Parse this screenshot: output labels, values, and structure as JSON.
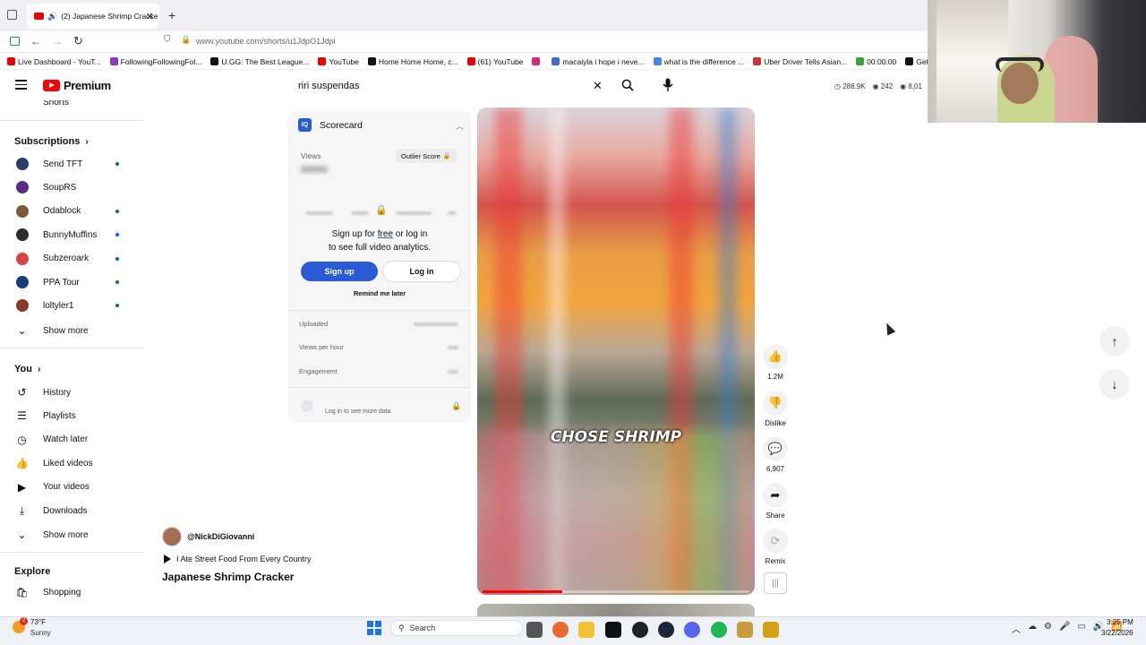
{
  "browser": {
    "tab_title": "(2) Japanese Shrimp Cracke",
    "new_tab": "+",
    "url": "www.youtube.com/shorts/u1JdpO1Jdpl"
  },
  "bookmarks": [
    {
      "label": "Live Dashboard - YouT...",
      "color": "#e00"
    },
    {
      "label": "FollowingFollowingFol...",
      "color": "#8a3ac9"
    },
    {
      "label": "U.GG: The Best League...",
      "color": "#111"
    },
    {
      "label": "YouTube",
      "color": "#e00"
    },
    {
      "label": "Home Home Home, c...",
      "color": "#111"
    },
    {
      "label": "(61) YouTube",
      "color": "#e00"
    },
    {
      "label": "",
      "color": "#d62976"
    },
    {
      "label": "macaiyla i hope i neve...",
      "color": "#3b6fd6"
    },
    {
      "label": "what is the difference ...",
      "color": "#4285f4"
    },
    {
      "label": "Uber Driver Tells Asian...",
      "color": "#c33"
    },
    {
      "label": "00:00:00",
      "color": "#3a3"
    },
    {
      "label": "Get The F--- Out Of M...",
      "color": "#111"
    }
  ],
  "header": {
    "logo_text": "Premium",
    "search_value": "riri suspendas",
    "stats": [
      "288.9K",
      "242",
      "8,01"
    ]
  },
  "sidebar": {
    "top_partial": "Shorts",
    "subscriptions_heading": "Subscriptions",
    "subscriptions": [
      {
        "label": "Send TFT",
        "color": "#2b3a6b",
        "dot": true
      },
      {
        "label": "SoupRS",
        "color": "#5d2a8a",
        "dot": false
      },
      {
        "label": "Odablock",
        "color": "#7a5a3a",
        "dot": true
      },
      {
        "label": "BunnyMuffins",
        "color": "#2c2c2c",
        "dot": true
      },
      {
        "label": "Subzeroark",
        "color": "#d94444",
        "dot": true
      },
      {
        "label": "PPA Tour",
        "color": "#1c3d7a",
        "dot": true
      },
      {
        "label": "loltyler1",
        "color": "#8a3a2a",
        "dot": true
      }
    ],
    "show_more_1": "Show more",
    "you_heading": "You",
    "you_items": [
      {
        "label": "History",
        "icon": "history-icon",
        "glyph": "↺"
      },
      {
        "label": "Playlists",
        "icon": "playlists-icon",
        "glyph": "☰"
      },
      {
        "label": "Watch later",
        "icon": "watch-later-icon",
        "glyph": "◷"
      },
      {
        "label": "Liked videos",
        "icon": "like-icon",
        "glyph": "👍"
      },
      {
        "label": "Your videos",
        "icon": "your-videos-icon",
        "glyph": "▶"
      },
      {
        "label": "Downloads",
        "icon": "download-icon",
        "glyph": "⤓"
      }
    ],
    "show_more_2": "Show more",
    "explore_heading": "Explore",
    "explore_items": [
      {
        "label": "Shopping",
        "icon": "shopping-bag-icon",
        "glyph": "🛍"
      }
    ]
  },
  "scorecard": {
    "title": "Scorecard",
    "views_label": "Views",
    "outlier_label": "Outlier Score",
    "signup_text_1": "Sign up for",
    "signup_free": "free",
    "signup_text_2": "or log in",
    "signup_text_3": "to see full video analytics.",
    "signup_button": "Sign up",
    "login_button": "Log in",
    "remind_label": "Remind me later",
    "uploaded_label": "Uploaded",
    "views_per_hour_label": "Views per hour",
    "engagement_label": "Engagement",
    "login_more_label": "Log in to see more data"
  },
  "video": {
    "caption": "CHOSE SHRIMP",
    "progress": 0.3,
    "channel": "@NickDiGiovanni",
    "playlist": "I Ate Street Food From Every Country",
    "title": "Japanese Shrimp Cracker"
  },
  "actions": {
    "like_count": "1.2M",
    "dislike_label": "Dislike",
    "comment_count": "6,907",
    "share_label": "Share",
    "remix_label": "Remix"
  },
  "taskbar": {
    "weather_temp": "73°F",
    "weather_desc": "Sunny",
    "search_label": "Search",
    "time": "3:25 PM",
    "date": "3/22/2026",
    "notif_badge": "2"
  }
}
